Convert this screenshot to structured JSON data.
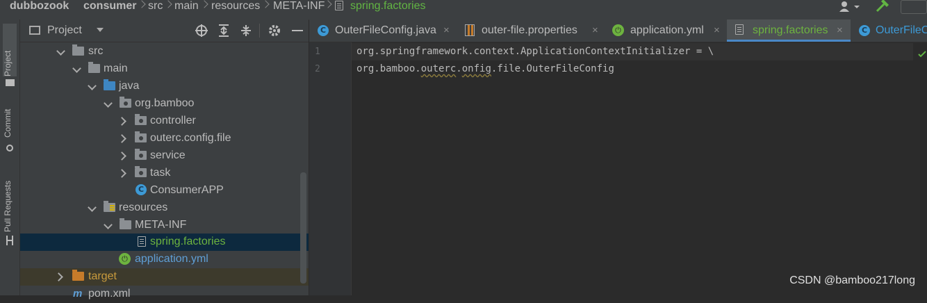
{
  "breadcrumb": {
    "items": [
      "dubbozook",
      "consumer",
      "src",
      "main",
      "resources",
      "META-INF",
      "spring.factories"
    ]
  },
  "sidebar_strip": {
    "project": "Project",
    "commit": "Commit",
    "pull_requests": "Pull Requests"
  },
  "project_panel": {
    "title": "Project"
  },
  "tree": [
    {
      "label": "src"
    },
    {
      "label": "main"
    },
    {
      "label": "java"
    },
    {
      "label": "org.bamboo"
    },
    {
      "label": "controller"
    },
    {
      "label": "outerc.config.file"
    },
    {
      "label": "service"
    },
    {
      "label": "task"
    },
    {
      "label": "ConsumerAPP"
    },
    {
      "label": "resources"
    },
    {
      "label": "META-INF"
    },
    {
      "label": "spring.factories"
    },
    {
      "label": "application.yml"
    },
    {
      "label": "target"
    },
    {
      "label": "pom.xml"
    }
  ],
  "tabs": [
    {
      "label": "OuterFileConfig.java",
      "close": "×"
    },
    {
      "label": "outer-file.properties",
      "close": "×"
    },
    {
      "label": "application.yml",
      "close": "×"
    },
    {
      "label": "spring.factories",
      "close": "×"
    },
    {
      "label": "OuterFileC"
    }
  ],
  "editor": {
    "line_numbers": [
      "1",
      "2"
    ],
    "line1": "org.springframework.context.ApplicationContextInitializer = \\",
    "line2_a": "org.bamboo.",
    "line2_b": "outerc",
    "line2_c": ".",
    "line2_d": "onfig",
    "line2_e": ".file.OuterFileConfig"
  },
  "watermark": "CSDN @bamboo217long",
  "colors": {
    "accent": "#4a88c7",
    "selection": "#0d293e",
    "spring_green": "#6db33f",
    "class_blue": "#3d9ad6"
  }
}
